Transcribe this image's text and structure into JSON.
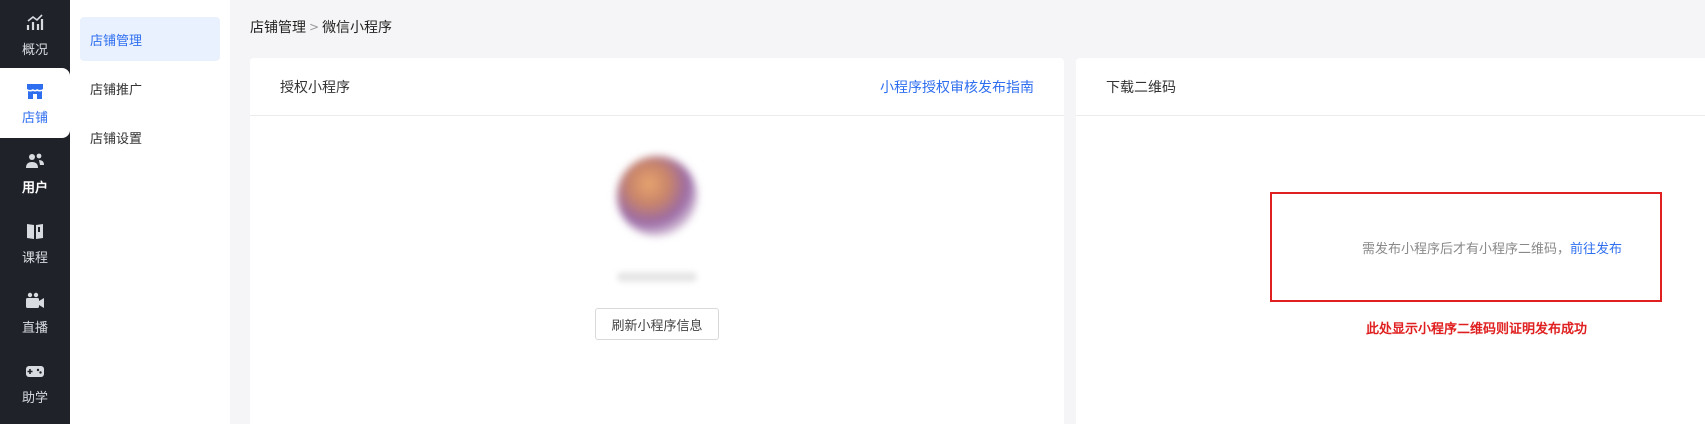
{
  "rail": {
    "items": [
      {
        "label": "概况",
        "icon": "chart-trend-icon"
      },
      {
        "label": "店铺",
        "icon": "store-icon",
        "active": true
      },
      {
        "label": "用户",
        "icon": "users-icon"
      },
      {
        "label": "课程",
        "icon": "book-icon"
      },
      {
        "label": "直播",
        "icon": "video-camera-icon"
      },
      {
        "label": "助学",
        "icon": "gamepad-icon"
      }
    ]
  },
  "submenu": {
    "items": [
      {
        "label": "店铺管理",
        "active": true
      },
      {
        "label": "店铺推广"
      },
      {
        "label": "店铺设置"
      }
    ]
  },
  "breadcrumb": {
    "parent": "店铺管理",
    "separator": ">",
    "current": "微信小程序"
  },
  "authorize": {
    "title": "授权小程序",
    "guide_link": "小程序授权审核发布指南",
    "refresh_button": "刷新小程序信息"
  },
  "download": {
    "title": "下载二维码",
    "notice": "需发布小程序后才有小程序二维码，",
    "publish_link": "前往发布",
    "annotation": "此处显示小程序二维码则证明发布成功"
  },
  "colors": {
    "accent": "#2f6fef",
    "rail_bg": "#1f2329",
    "annotation": "#e02020"
  }
}
